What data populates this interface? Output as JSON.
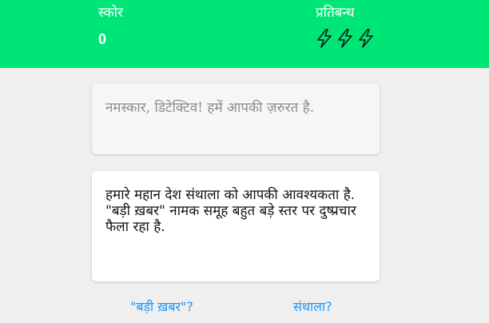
{
  "header": {
    "score_label": "स्कोर",
    "score_value": "0",
    "restriction_label": "प्रतिबन्ध",
    "lives": 3,
    "lives_icon": "lightning-bolt-icon",
    "bg_color": "#00e676"
  },
  "messages": {
    "greeting": "नमस्कार, डिटेक्टिव! हमें आपकी ज़रुरत है.",
    "story": "हमारे महान देश संथाला को आपकी आवश्यकता है. \"बड़ी ख़बर\" नामक समूह बहुत बड़े स्तर पर दुष्प्रचार फैला रहा है."
  },
  "choices": {
    "option_1": "\"बड़ी ख़बर\"?",
    "option_2": "संथाला?",
    "link_color": "#2196f3"
  }
}
